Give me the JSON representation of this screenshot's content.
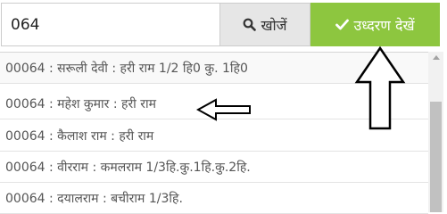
{
  "search": {
    "value": "064",
    "button_label": "खोजें"
  },
  "actions": {
    "view_label": "उध्दरण देखें",
    "accent_color": "#8dc63f"
  },
  "results": [
    {
      "text": "00064 : सरूली देवी : हरी राम 1/2 हि0 कु. 1हि0"
    },
    {
      "text": "00064 : महेश कुमार : हरी राम"
    },
    {
      "text": "00064 : कैलाश राम : हरी राम"
    },
    {
      "text": "00064 : वीरराम : कमलराम 1/3हि.कु.1हि.कु.2हि."
    },
    {
      "text": "00064 : दयालराम : बचीराम 1/3हि."
    }
  ],
  "icons": {
    "search_button": "search-icon",
    "view_button": "check-icon",
    "scroll_up": "chevron-up-icon"
  }
}
